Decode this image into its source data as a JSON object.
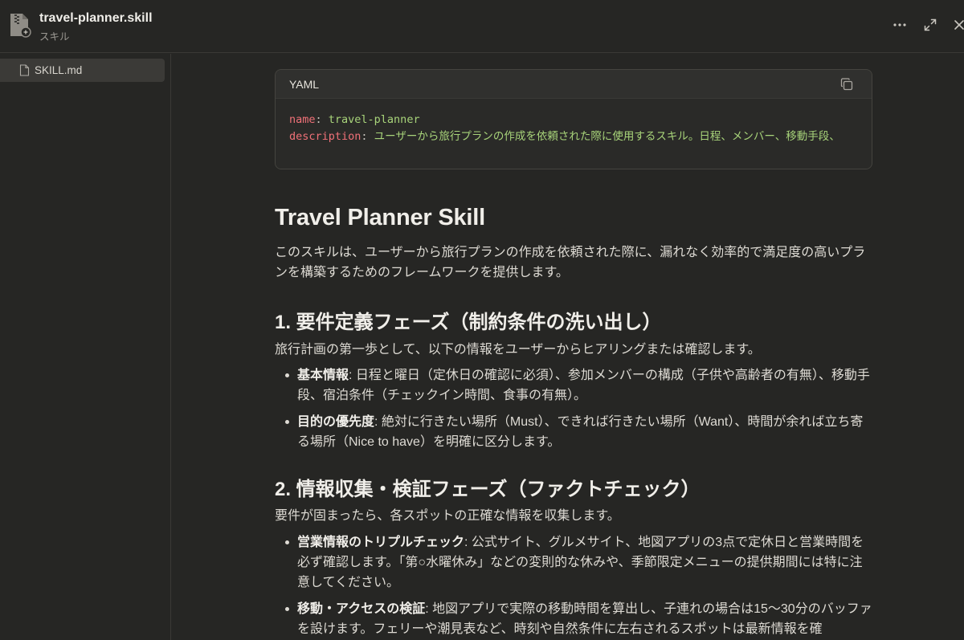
{
  "header": {
    "title": "travel-planner.skill",
    "subtitle": "スキル",
    "icons": [
      "archive-file-icon",
      "more-icon",
      "expand-icon",
      "close-icon"
    ]
  },
  "sidebar": {
    "items": [
      {
        "label": "SKILL.md",
        "icon": "document-icon",
        "selected": true
      }
    ]
  },
  "code": {
    "language": "YAML",
    "lines": [
      {
        "key": "name",
        "sep": ": ",
        "value": "travel-planner"
      },
      {
        "key": "description",
        "sep": ": ",
        "value": "ユーザーから旅行プランの作成を依頼された際に使用するスキル。日程、メンバー、移動手段、"
      }
    ]
  },
  "doc": {
    "title": "Travel Planner Skill",
    "intro": "このスキルは、ユーザーから旅行プランの作成を依頼された際に、漏れなく効率的で満足度の高いプランを構築するためのフレームワークを提供します。",
    "sections": [
      {
        "heading": "1. 要件定義フェーズ（制約条件の洗い出し）",
        "lead": "旅行計画の第一歩として、以下の情報をユーザーからヒアリングまたは確認します。",
        "items": [
          {
            "term": "基本情報",
            "text": ": 日程と曜日（定休日の確認に必須）、参加メンバーの構成（子供や高齢者の有無）、移動手段、宿泊条件（チェックイン時間、食事の有無）。"
          },
          {
            "term": "目的の優先度",
            "text": ": 絶対に行きたい場所（Must）、できれば行きたい場所（Want）、時間が余れば立ち寄る場所（Nice to have）を明確に区分します。"
          }
        ]
      },
      {
        "heading": "2. 情報収集・検証フェーズ（ファクトチェック）",
        "lead": "要件が固まったら、各スポットの正確な情報を収集します。",
        "items": [
          {
            "term": "営業情報のトリプルチェック",
            "text": ": 公式サイト、グルメサイト、地図アプリの3点で定休日と営業時間を必ず確認します。「第○水曜休み」などの変則的な休みや、季節限定メニューの提供期間には特に注意してください。"
          },
          {
            "term": "移動・アクセスの検証",
            "text": ": 地図アプリで実際の移動時間を算出し、子連れの場合は15〜30分のバッファを設けます。フェリーや潮見表など、時刻や自然条件に左右されるスポットは最新情報を確"
          }
        ]
      }
    ]
  }
}
